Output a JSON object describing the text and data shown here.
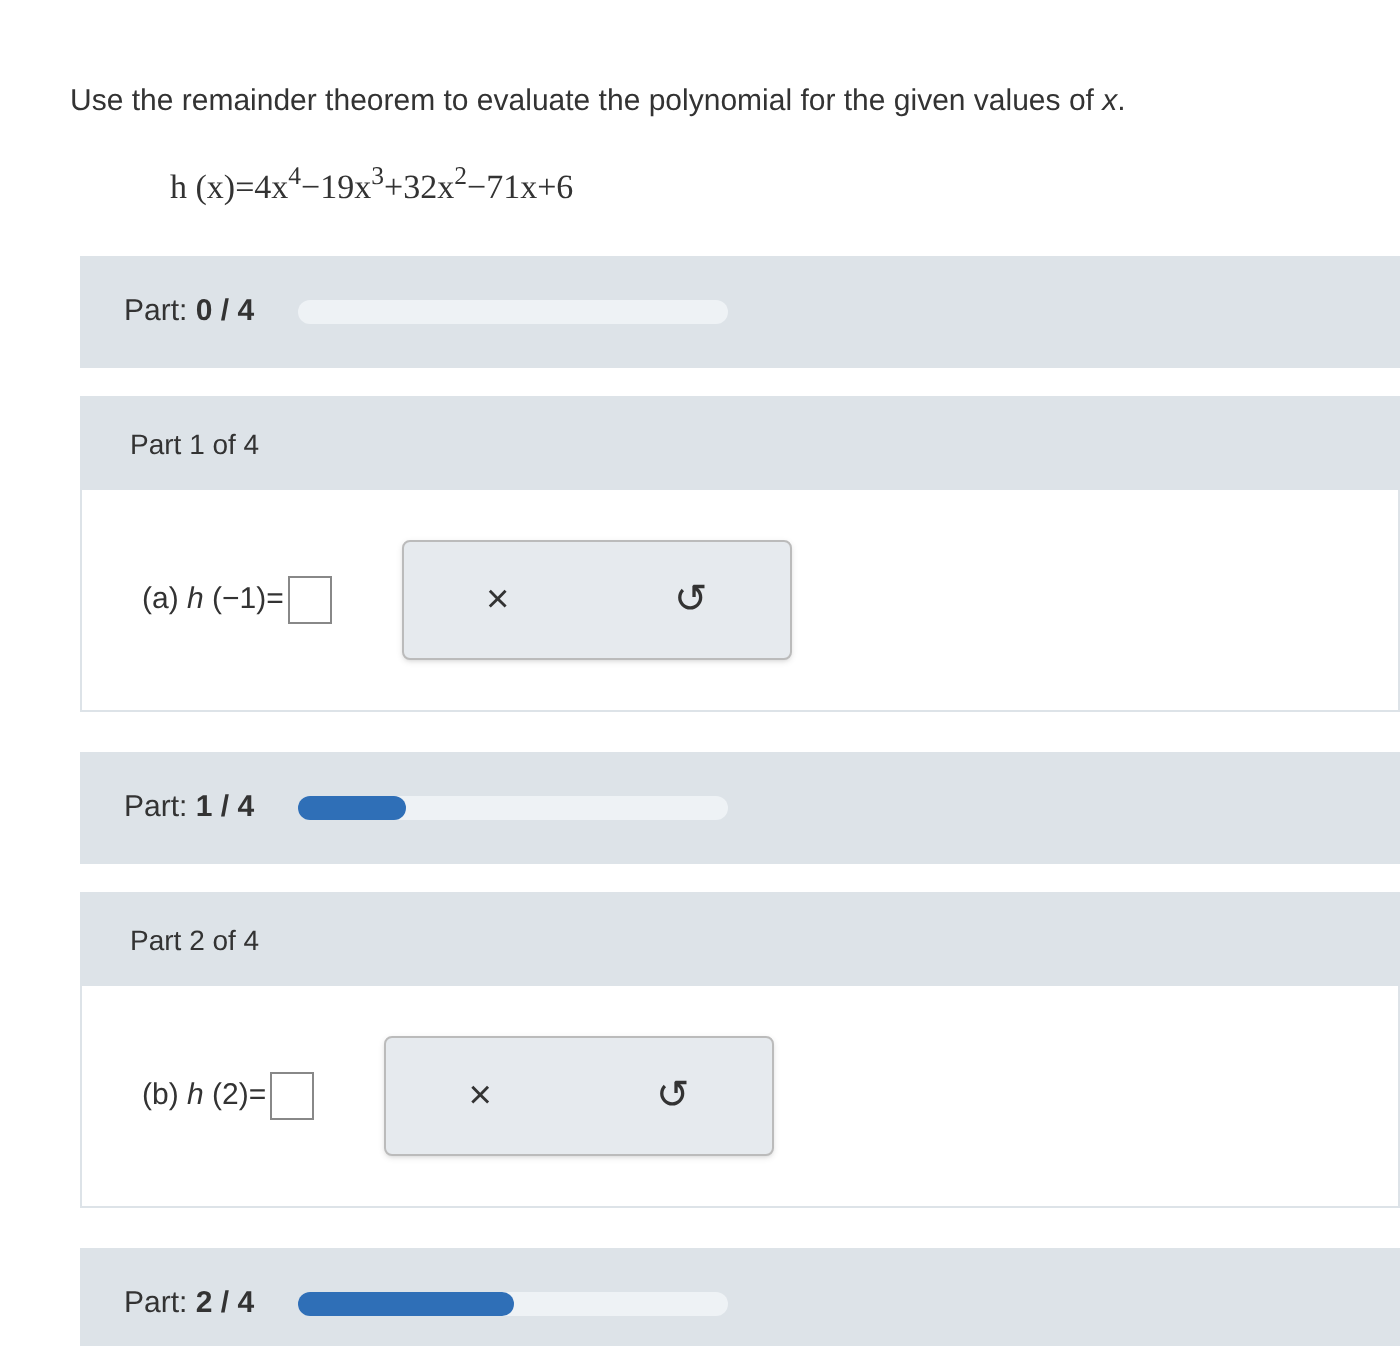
{
  "instruction": "Use the remainder theorem to evaluate the polynomial for the given values of *x*.",
  "formula": "h (x)=4x$^{4}$−19x$^{3}$+32x$^{2}$−71x+6",
  "blocks": [
    {
      "kind": "progress",
      "label": "Part:",
      "value": "0 / 4",
      "level": 0
    },
    {
      "kind": "part",
      "title": "Part 1 of 4",
      "question": "(a) *h* (−1)=",
      "clear": "×",
      "undo": "↺"
    },
    {
      "kind": "progress",
      "label": "Part:",
      "value": "1 / 4",
      "level": 0.25
    },
    {
      "kind": "part",
      "title": "Part 2 of 4",
      "question": "(b) *h* (2)=",
      "clear": "×",
      "undo": "↺"
    },
    {
      "kind": "progress",
      "label": "Part:",
      "value": "2 / 4",
      "level": 0.5
    }
  ]
}
